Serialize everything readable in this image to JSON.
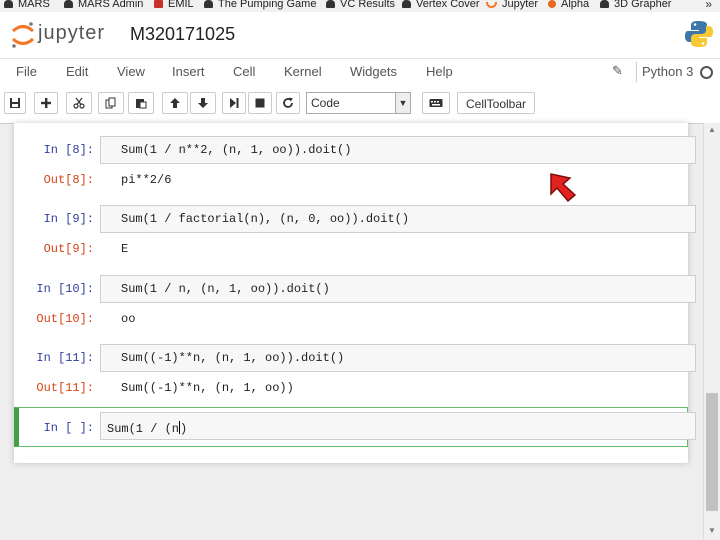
{
  "bookmarks": [
    "MARS",
    "MARS Admin",
    "EMIL",
    "The Pumping Game",
    "VC Results",
    "Vertex Cover",
    "Jupyter",
    "Alpha",
    "3D Grapher"
  ],
  "header": {
    "logo_text": "jupyter",
    "notebook_title": "M320171025"
  },
  "menu": [
    "File",
    "Edit",
    "View",
    "Insert",
    "Cell",
    "Kernel",
    "Widgets",
    "Help"
  ],
  "kernel": {
    "name": "Python 3"
  },
  "toolbar": {
    "cell_type": "Code",
    "celltoolbar_label": "CellToolbar"
  },
  "cells": [
    {
      "in_prompt": "In [8]:",
      "code": "Sum(1 / n**2, (n, 1, oo)).doit()",
      "out_prompt": "Out[8]:",
      "output": "pi**2/6"
    },
    {
      "in_prompt": "In [9]:",
      "code": "Sum(1 / factorial(n), (n, 0, oo)).doit()",
      "out_prompt": "Out[9]:",
      "output": "E"
    },
    {
      "in_prompt": "In [10]:",
      "code": "Sum(1 / n, (n, 1, oo)).doit()",
      "out_prompt": "Out[10]:",
      "output": "oo"
    },
    {
      "in_prompt": "In [11]:",
      "code": "Sum((-1)**n, (n, 1, oo)).doit()",
      "out_prompt": "Out[11]:",
      "output": "Sum((-1)**n, (n, 1, oo))"
    }
  ],
  "active_cell": {
    "in_prompt": "In [ ]:",
    "code_before": "Sum(1 / (n",
    "code_after": ")"
  }
}
